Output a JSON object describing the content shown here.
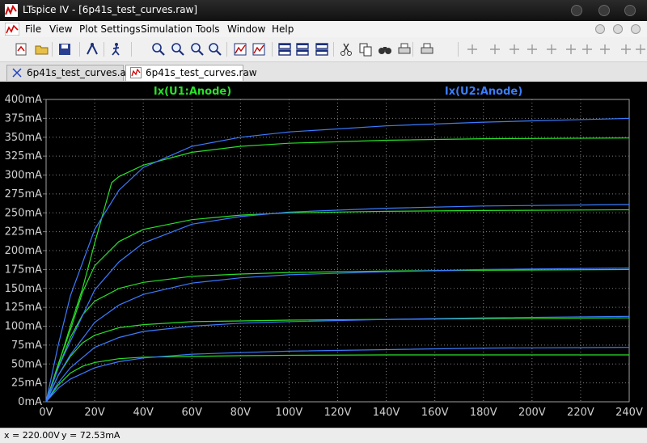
{
  "window": {
    "title": "LTspice IV - [6p41s_test_curves.raw]"
  },
  "menu": [
    {
      "label": "File"
    },
    {
      "label": "View"
    },
    {
      "label": "Plot Settings"
    },
    {
      "label": "Simulation"
    },
    {
      "label": "Tools"
    },
    {
      "label": "Window"
    },
    {
      "label": "Help"
    }
  ],
  "toolbar": {
    "icons": [
      "new-schematic-icon",
      "open-icon",
      "save-icon",
      "control-panel-icon",
      "run-icon",
      "zoom-in-icon",
      "zoom-out-icon",
      "zoom-fit-icon",
      "zoom-cancel-icon",
      "autorange-icon",
      "cursor-icon",
      "tile-horizontal-icon",
      "cascade-icon",
      "tile-icon",
      "cut-icon",
      "copy-icon",
      "find-icon",
      "print-preview-icon",
      "print-icon",
      "pencil-icon",
      "ground-icon",
      "label-icon",
      "resistor-icon",
      "capacitor-icon",
      "inductor-icon",
      "diode-icon",
      "component-icon",
      "move-hand-icon",
      "drag-hand-icon"
    ]
  },
  "tabs": [
    {
      "label": "6p41s_test_curves.asc",
      "icon": "schematic-icon",
      "active": false
    },
    {
      "label": "6p41s_test_curves.raw",
      "icon": "waveform-icon",
      "active": true
    }
  ],
  "status": {
    "x": "x = 220.00V",
    "y": "y = 72.53mA"
  },
  "colors": {
    "background": "#000000",
    "grid": "#808080",
    "axis_text": "#d0d0d0",
    "trace1": "#28e028",
    "trace2": "#3a7cff"
  },
  "chart_data": {
    "type": "line",
    "title": "",
    "xlabel": "",
    "ylabel": "",
    "xlim": [
      0,
      240
    ],
    "ylim": [
      0,
      400
    ],
    "x_ticks": [
      "0V",
      "20V",
      "40V",
      "60V",
      "80V",
      "100V",
      "120V",
      "140V",
      "160V",
      "180V",
      "200V",
      "220V",
      "240V"
    ],
    "y_ticks": [
      "0mA",
      "25mA",
      "50mA",
      "75mA",
      "100mA",
      "125mA",
      "150mA",
      "175mA",
      "200mA",
      "225mA",
      "250mA",
      "275mA",
      "300mA",
      "325mA",
      "350mA",
      "375mA",
      "400mA"
    ],
    "grid": true,
    "series": [
      {
        "name": "Ix(U1:Anode)",
        "color": "#28e028",
        "curves": [
          {
            "x": [
              0,
              5,
              10,
              15,
              20,
              30,
              40,
              60,
              80,
              100,
              140,
              180,
              240
            ],
            "y": [
              0,
              22,
              38,
              47,
              52,
              57,
              59,
              60,
              61,
              61.5,
              62,
              62,
              62
            ]
          },
          {
            "x": [
              0,
              5,
              10,
              15,
              20,
              30,
              40,
              60,
              80,
              100,
              140,
              180,
              240
            ],
            "y": [
              0,
              35,
              60,
              78,
              88,
              98,
              102,
              106,
              107,
              108,
              109,
              110,
              111
            ]
          },
          {
            "x": [
              0,
              5,
              10,
              15,
              20,
              30,
              40,
              60,
              80,
              100,
              140,
              180,
              240
            ],
            "y": [
              0,
              45,
              85,
              115,
              133,
              150,
              158,
              166,
              169,
              171,
              173,
              174,
              175
            ]
          },
          {
            "x": [
              0,
              5,
              10,
              15,
              20,
              30,
              40,
              60,
              80,
              100,
              140,
              180,
              240
            ],
            "y": [
              0,
              50,
              95,
              145,
              180,
              212,
              228,
              241,
              247,
              250,
              252,
              253,
              254
            ]
          },
          {
            "x": [
              0,
              5,
              10,
              15,
              20,
              27,
              30,
              40,
              60,
              80,
              100,
              140,
              180,
              240
            ],
            "y": [
              0,
              48,
              100,
              150,
              210,
              290,
              298,
              313,
              330,
              338,
              342,
              346,
              348,
              349
            ]
          }
        ]
      },
      {
        "name": "Ix(U2:Anode)",
        "color": "#3a7cff",
        "curves": [
          {
            "x": [
              0,
              5,
              10,
              20,
              30,
              40,
              60,
              80,
              100,
              140,
              180,
              240
            ],
            "y": [
              0,
              18,
              30,
              45,
              53,
              58,
              63,
              65,
              67,
              69,
              71,
              72
            ]
          },
          {
            "x": [
              0,
              5,
              10,
              20,
              30,
              40,
              60,
              80,
              100,
              140,
              180,
              240
            ],
            "y": [
              0,
              25,
              45,
              72,
              85,
              93,
              100,
              104,
              106,
              109,
              111,
              113
            ]
          },
          {
            "x": [
              0,
              5,
              10,
              20,
              30,
              40,
              60,
              80,
              100,
              140,
              180,
              240
            ],
            "y": [
              0,
              35,
              62,
              105,
              128,
              142,
              157,
              164,
              168,
              172,
              175,
              177
            ]
          },
          {
            "x": [
              0,
              5,
              10,
              20,
              30,
              40,
              60,
              80,
              100,
              140,
              180,
              240
            ],
            "y": [
              0,
              45,
              80,
              148,
              185,
              210,
              235,
              245,
              251,
              256,
              259,
              261
            ]
          },
          {
            "x": [
              0,
              5,
              10,
              20,
              30,
              40,
              60,
              80,
              100,
              140,
              180,
              240
            ],
            "y": [
              0,
              75,
              140,
              228,
              280,
              310,
              338,
              350,
              357,
              365,
              370,
              375
            ]
          }
        ]
      }
    ]
  }
}
